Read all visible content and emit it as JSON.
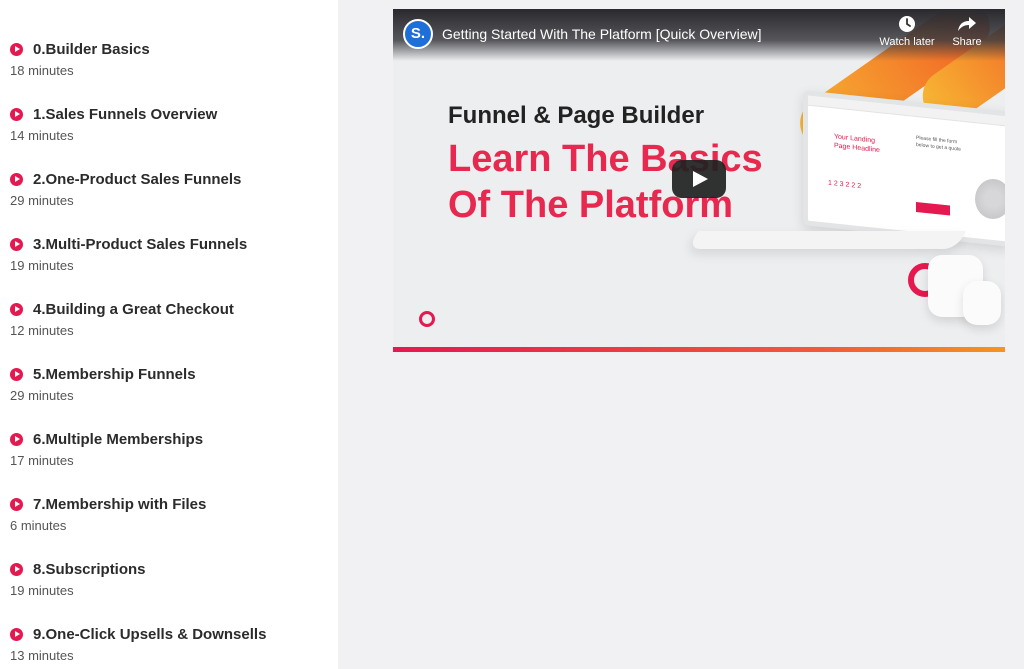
{
  "lessons": [
    {
      "title": "0.Builder Basics",
      "duration": "18 minutes"
    },
    {
      "title": "1.Sales Funnels Overview",
      "duration": "14 minutes"
    },
    {
      "title": "2.One-Product Sales Funnels",
      "duration": "29 minutes"
    },
    {
      "title": "3.Multi-Product Sales Funnels",
      "duration": "19 minutes"
    },
    {
      "title": "4.Building a Great Checkout",
      "duration": "12 minutes"
    },
    {
      "title": "5.Membership Funnels",
      "duration": "29 minutes"
    },
    {
      "title": "6.Multiple Memberships",
      "duration": "17 minutes"
    },
    {
      "title": "7.Membership with Files",
      "duration": "6 minutes"
    },
    {
      "title": "8.Subscriptions",
      "duration": "19 minutes"
    },
    {
      "title": "9.One-Click Upsells & Downsells",
      "duration": "13 minutes"
    }
  ],
  "video": {
    "channel_initial": "S.",
    "title": "Getting Started With The Platform [Quick Overview]",
    "watch_later_label": "Watch later",
    "share_label": "Share",
    "promo_subtitle": "Funnel & Page Builder",
    "promo_headline": "Learn The Basics Of The Platform",
    "mock_page_headline": "Your Landing Page Headline",
    "mock_counter": "1 2 3 2 2 2",
    "mock_side_text": "Please fill the form below to get a quote"
  },
  "colors": {
    "accent": "#e5184f",
    "promo_headline": "#e8294f",
    "stripe_start": "#f7b733",
    "stripe_end": "#f15a24",
    "channel_avatar": "#1f6fd8"
  },
  "icons": {
    "lesson": "play-circle-icon",
    "watch_later": "clock-icon",
    "share": "share-arrow-icon",
    "player": "youtube-play-icon"
  }
}
